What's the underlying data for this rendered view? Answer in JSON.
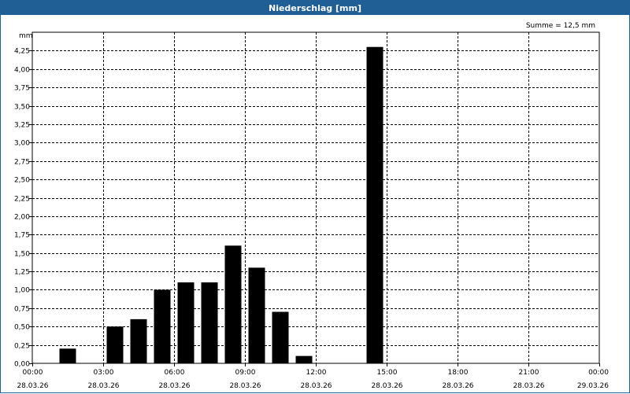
{
  "window": {
    "title": "Niederschlag [mm]"
  },
  "chart_data": {
    "type": "bar",
    "title": "Niederschlag [mm]",
    "ylabel": "mm",
    "annotation": "Summe = 12,5 mm",
    "xlim": [
      0,
      24
    ],
    "ylim": [
      0,
      4.5
    ],
    "yticks": [
      0,
      0.25,
      0.5,
      0.75,
      1,
      1.25,
      1.5,
      1.75,
      2,
      2.25,
      2.5,
      2.75,
      3,
      3.25,
      3.5,
      3.75,
      4,
      4.25
    ],
    "ytick_labels": [
      "0,00",
      "0,25",
      "0,50",
      "0,75",
      "1,00",
      "1,25",
      "1,50",
      "1,75",
      "2,00",
      "2,25",
      "2,50",
      "2,75",
      "3,00",
      "3,25",
      "3,50",
      "3,75",
      "4,00",
      "4,25"
    ],
    "xticks": [
      0,
      3,
      6,
      9,
      12,
      15,
      18,
      21,
      24
    ],
    "xtick_labels": [
      [
        "00:00",
        "28.03.26"
      ],
      [
        "03:00",
        "28.03.26"
      ],
      [
        "06:00",
        "28.03.26"
      ],
      [
        "09:00",
        "28.03.26"
      ],
      [
        "12:00",
        "28.03.26"
      ],
      [
        "15:00",
        "28.03.26"
      ],
      [
        "18:00",
        "28.03.26"
      ],
      [
        "21:00",
        "28.03.26"
      ],
      [
        "00:00",
        "29.03.26"
      ]
    ],
    "categories": [
      "00:00",
      "01:00",
      "02:00",
      "03:00",
      "04:00",
      "05:00",
      "06:00",
      "07:00",
      "08:00",
      "09:00",
      "10:00",
      "11:00",
      "12:00",
      "13:00",
      "14:00",
      "15:00",
      "16:00",
      "17:00",
      "18:00",
      "19:00",
      "20:00",
      "21:00",
      "22:00",
      "23:00"
    ],
    "values": [
      0,
      0.2,
      0,
      0.5,
      0.6,
      1.0,
      1.1,
      1.1,
      1.6,
      1.3,
      0.7,
      0.1,
      0,
      0,
      4.3,
      0,
      0,
      0,
      0,
      0,
      0,
      0,
      0,
      0
    ],
    "grid": true,
    "colors": {
      "bar": "#000000",
      "grid": "#000000",
      "titlebar": "#1f5f95"
    }
  }
}
